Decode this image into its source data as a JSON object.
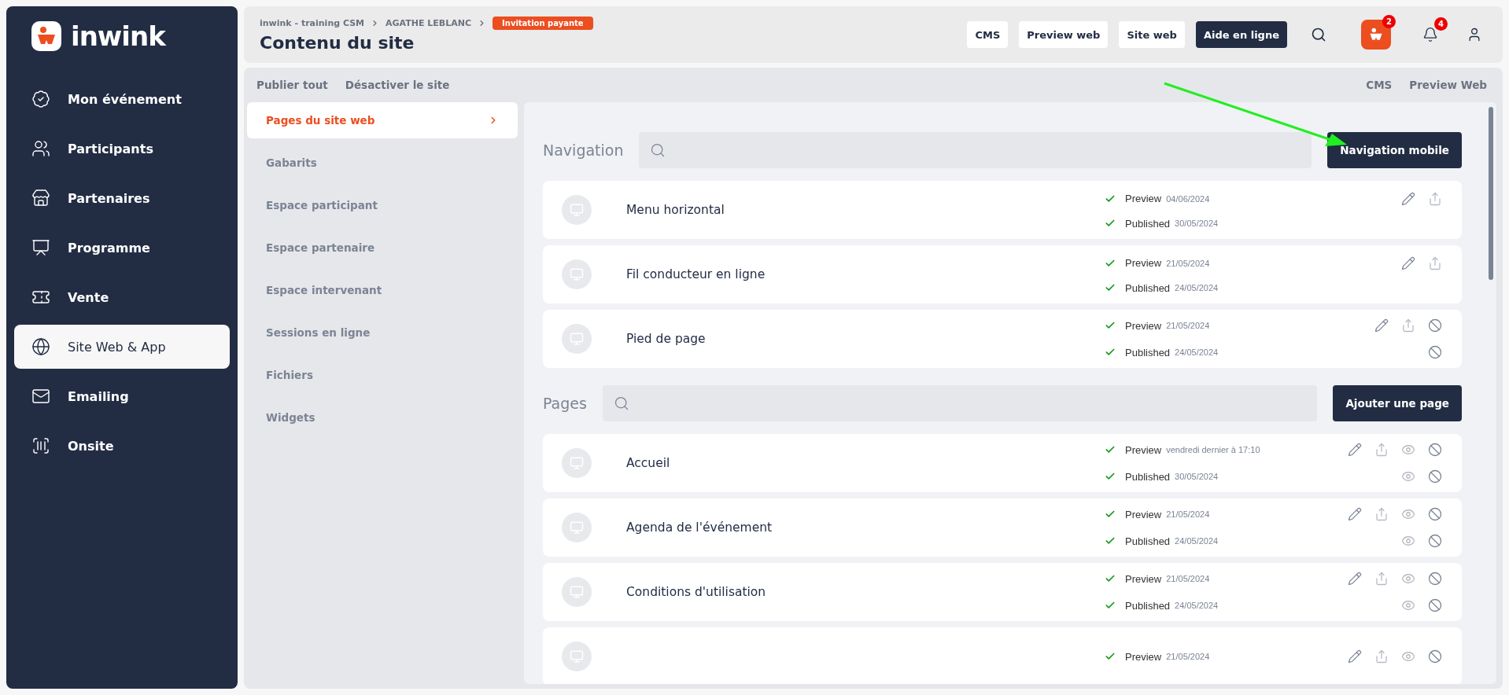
{
  "sidebar": {
    "brand": "inwink",
    "items": [
      {
        "label": "Mon événement",
        "selected": false
      },
      {
        "label": "Participants",
        "selected": false
      },
      {
        "label": "Partenaires",
        "selected": false
      },
      {
        "label": "Programme",
        "selected": false
      },
      {
        "label": "Vente",
        "selected": false
      },
      {
        "label": "Site Web & App",
        "selected": true
      },
      {
        "label": "Emailing",
        "selected": false
      },
      {
        "label": "Onsite",
        "selected": false
      }
    ]
  },
  "header": {
    "breadcrumb": [
      "inwink - training CSM",
      "AGATHE LEBLANC"
    ],
    "badge": "Invitation payante",
    "title": "Contenu du site",
    "buttons": [
      {
        "label": "CMS",
        "kind": "light"
      },
      {
        "label": "Preview web",
        "kind": "light"
      },
      {
        "label": "Site web",
        "kind": "light"
      },
      {
        "label": "Aide en ligne",
        "kind": "dark"
      }
    ],
    "app_badge": "2",
    "notification_badge": "4"
  },
  "toolbar": {
    "left": [
      "Publier tout",
      "Désactiver le site"
    ],
    "right": [
      "CMS",
      "Preview Web"
    ]
  },
  "submenu": [
    {
      "label": "Pages du site web",
      "selected": true
    },
    {
      "label": "Gabarits",
      "selected": false
    },
    {
      "label": "Espace participant",
      "selected": false
    },
    {
      "label": "Espace partenaire",
      "selected": false
    },
    {
      "label": "Espace intervenant",
      "selected": false
    },
    {
      "label": "Sessions en ligne",
      "selected": false
    },
    {
      "label": "Fichiers",
      "selected": false
    },
    {
      "label": "Widgets",
      "selected": false
    }
  ],
  "sections": [
    {
      "title": "Navigation",
      "button": "Navigation mobile",
      "rows": [
        {
          "name": "Menu horizontal",
          "lines": [
            {
              "label": "Preview",
              "date": "04/06/2024",
              "actions": [
                {
                  "kind": "edit"
                },
                {
                  "kind": "share"
                }
              ]
            },
            {
              "label": "Published",
              "date": "30/05/2024"
            }
          ]
        },
        {
          "name": "Fil conducteur en ligne",
          "lines": [
            {
              "label": "Preview",
              "date": "21/05/2024",
              "actions": [
                {
                  "kind": "edit"
                },
                {
                  "kind": "share"
                }
              ]
            },
            {
              "label": "Published",
              "date": "24/05/2024"
            }
          ]
        },
        {
          "name": "Pied de page",
          "lines": [
            {
              "label": "Preview",
              "date": "21/05/2024",
              "actions": [
                {
                  "kind": "edit"
                },
                {
                  "kind": "share"
                },
                {
                  "kind": "disable"
                }
              ]
            },
            {
              "label": "Published",
              "date": "24/05/2024",
              "actions": [
                {
                  "kind": "disable"
                }
              ]
            }
          ]
        }
      ]
    },
    {
      "title": "Pages",
      "button": "Ajouter une page",
      "rows": [
        {
          "name": "Accueil",
          "lines": [
            {
              "label": "Preview",
              "date": "vendredi dernier à 17:10",
              "actions": [
                {
                  "kind": "edit"
                },
                {
                  "kind": "share"
                },
                {
                  "kind": "view"
                },
                {
                  "kind": "disable"
                }
              ]
            },
            {
              "label": "Published",
              "date": "30/05/2024",
              "actions": [
                {
                  "kind": "view"
                },
                {
                  "kind": "disable"
                }
              ]
            }
          ]
        },
        {
          "name": "Agenda de l'événement",
          "lines": [
            {
              "label": "Preview",
              "date": "21/05/2024",
              "actions": [
                {
                  "kind": "edit"
                },
                {
                  "kind": "share"
                },
                {
                  "kind": "view"
                },
                {
                  "kind": "disable"
                }
              ]
            },
            {
              "label": "Published",
              "date": "24/05/2024",
              "actions": [
                {
                  "kind": "view"
                },
                {
                  "kind": "disable"
                }
              ]
            }
          ]
        },
        {
          "name": "Conditions d'utilisation",
          "lines": [
            {
              "label": "Preview",
              "date": "21/05/2024",
              "actions": [
                {
                  "kind": "edit"
                },
                {
                  "kind": "share"
                },
                {
                  "kind": "view"
                },
                {
                  "kind": "disable"
                }
              ]
            },
            {
              "label": "Published",
              "date": "24/05/2024",
              "actions": [
                {
                  "kind": "view"
                },
                {
                  "kind": "disable"
                }
              ]
            }
          ]
        },
        {
          "lines": [
            {
              "label": "Preview",
              "date": "21/05/2024",
              "actions": [
                {
                  "kind": "edit"
                },
                {
                  "kind": "share"
                },
                {
                  "kind": "view"
                },
                {
                  "kind": "disable"
                }
              ]
            }
          ]
        }
      ]
    }
  ]
}
